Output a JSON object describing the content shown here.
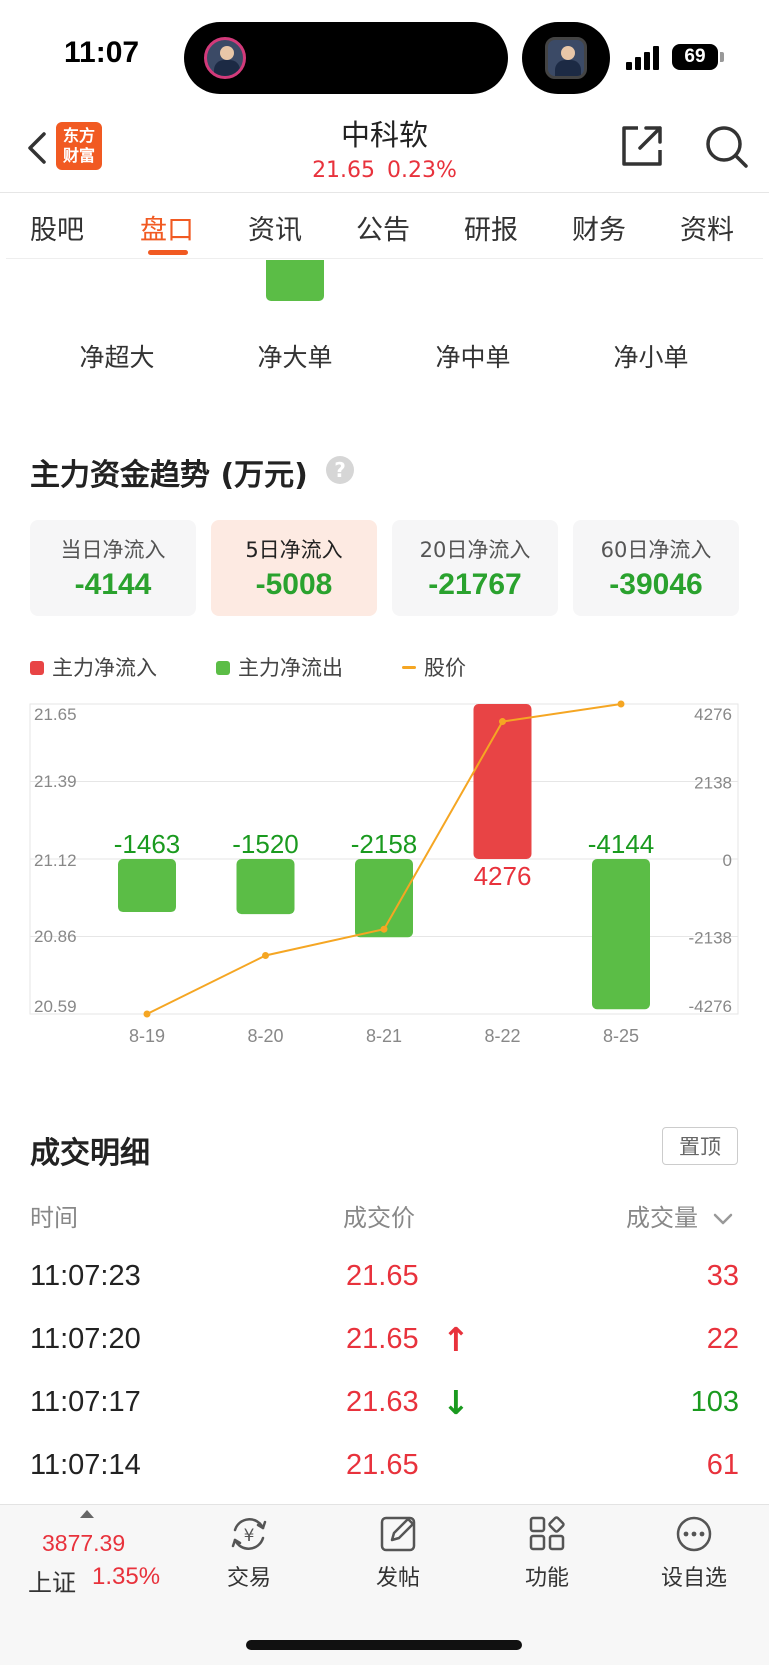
{
  "status_bar": {
    "time": "11:07",
    "battery": "69"
  },
  "header": {
    "logo_line1": "东方",
    "logo_line2": "财富",
    "stock_name": "中科软",
    "price": "21.65",
    "change_pct": "0.23%"
  },
  "tabs": [
    "股吧",
    "盘口",
    "资讯",
    "公告",
    "研报",
    "财务",
    "资料"
  ],
  "active_tab": "盘口",
  "distribution": {
    "labels": [
      "净超大",
      "净大单",
      "净中单",
      "净小单"
    ]
  },
  "trend": {
    "title": "主力资金趋势 (万元)",
    "help": "?",
    "cards": [
      {
        "label": "当日净流入",
        "value": "-4144"
      },
      {
        "label": "5日净流入",
        "value": "-5008"
      },
      {
        "label": "20日净流入",
        "value": "-21767"
      },
      {
        "label": "60日净流入",
        "value": "-39046"
      }
    ],
    "legend": {
      "inflow": "主力净流入",
      "outflow": "主力净流出",
      "price": "股价"
    }
  },
  "chart_data": {
    "type": "bar",
    "categories": [
      "8-19",
      "8-20",
      "8-21",
      "8-22",
      "8-25"
    ],
    "series": [
      {
        "name": "主力净流入/流出",
        "values": [
          -1463,
          -1520,
          -2158,
          4276,
          -4144
        ],
        "labels": [
          "-1463",
          "-1520",
          "-2158",
          "4276",
          "-4144"
        ]
      },
      {
        "name": "股价",
        "type": "line",
        "values": [
          20.59,
          20.79,
          20.88,
          21.59,
          21.65
        ]
      }
    ],
    "y_left_ticks": [
      "21.65",
      "21.39",
      "21.12",
      "20.86",
      "20.59"
    ],
    "y_left_range": [
      20.59,
      21.65
    ],
    "y_right_ticks": [
      "4276",
      "2138",
      "0",
      "-2138",
      "-4276"
    ],
    "y_right_range": [
      -4276,
      4276
    ],
    "colors": {
      "inflow": "#e84445",
      "outflow": "#5bbd46",
      "price": "#f5a623"
    },
    "grid": true
  },
  "details": {
    "title": "成交明细",
    "pin": "置顶",
    "headers": {
      "time": "时间",
      "price": "成交价",
      "volume": "成交量"
    },
    "rows": [
      {
        "time": "11:07:23",
        "price": "21.65",
        "arrow": "",
        "dir": "up",
        "volume": "33"
      },
      {
        "time": "11:07:20",
        "price": "21.65",
        "arrow": "↑",
        "dir": "up",
        "volume": "22"
      },
      {
        "time": "11:07:17",
        "price": "21.63",
        "arrow": "↓",
        "dir": "down",
        "volume": "103"
      },
      {
        "time": "11:07:14",
        "price": "21.65",
        "arrow": "",
        "dir": "up",
        "volume": "61"
      }
    ]
  },
  "bottom_bar": {
    "index_value": "3877.39",
    "index_name": "上证",
    "index_pct": "1.35%",
    "items": [
      {
        "label": "交易",
        "icon": "yen-exchange-icon"
      },
      {
        "label": "发帖",
        "icon": "compose-icon"
      },
      {
        "label": "功能",
        "icon": "apps-icon"
      },
      {
        "label": "设自选",
        "icon": "more-icon"
      }
    ]
  }
}
